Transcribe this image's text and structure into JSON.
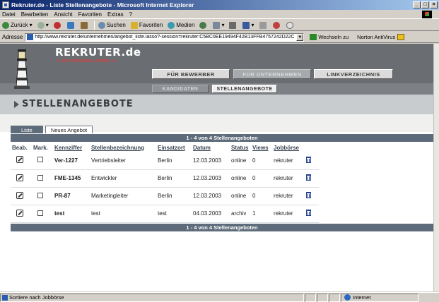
{
  "window": {
    "title": "Rekruter.de - Liste Stellenangebote - Microsoft Internet Explorer",
    "controls": [
      "_",
      "□",
      "×"
    ]
  },
  "menu": [
    "Datei",
    "Bearbeiten",
    "Ansicht",
    "Favoriten",
    "Extras",
    "?"
  ],
  "toolbar": {
    "back": "Zurück",
    "search": "Suchen",
    "favorites": "Favoriten",
    "media": "Medien"
  },
  "address": {
    "label": "Adresse",
    "url": "http://www.rekruter.de/unternehmen/angebot_liste.lasso?-session=rekruter:C5BC0EE19494F42B13FFB4757242D22C",
    "go": "Wechseln zu",
    "norton": "Norton AntiVirus"
  },
  "site": {
    "logo": "REKRUTER.de",
    "tagline": "<< DIE PERSONAL-BÖRSE >>",
    "nav": [
      "FÜR BEWERBER",
      "FÜR UNTERNEHMEN",
      "LINKVERZEICHNIS"
    ],
    "subnav": [
      "KANDIDATEN",
      "STELLENANGEBOTE"
    ],
    "heading": "STELLENANGEBOTE"
  },
  "list_tabs": {
    "list": "Liste",
    "new_offer": "Neues Angebot"
  },
  "results_header": "1 - 4 von 4 Stellenangeboten",
  "results_footer": "1 - 4 von 4 Stellenangeboten",
  "columns": {
    "beab": "Beab.",
    "mark": "Mark.",
    "kennziffer": "Kennziffer",
    "stellenbezeichnung": "Stellenbezeichnung",
    "einsatzort": "Einsatzort",
    "datum": "Datum",
    "status": "Status",
    "views": "Views",
    "jobboerse": "Jobbörse"
  },
  "rows": [
    {
      "kennziffer": "Ver-1227",
      "bezeichnung": "Vertriebsleiter",
      "ort": "Berlin",
      "datum": "12.03.2003",
      "status": "online",
      "views": "0",
      "boerse": "rekruter"
    },
    {
      "kennziffer": "FME-1345",
      "bezeichnung": "Entwickler",
      "ort": "Berlin",
      "datum": "12.03.2003",
      "status": "online",
      "views": "0",
      "boerse": "rekruter"
    },
    {
      "kennziffer": "PR-87",
      "bezeichnung": "Marketingleiter",
      "ort": "Berlin",
      "datum": "12.03.2003",
      "status": "online",
      "views": "0",
      "boerse": "rekruter"
    },
    {
      "kennziffer": "test",
      "bezeichnung": "test",
      "ort": "test",
      "datum": "04.03.2003",
      "status": "archiv",
      "views": "1",
      "boerse": "rekruter"
    }
  ],
  "statusbar": {
    "text": "Sortiere nach Jobbörse",
    "zone": "Internet"
  }
}
